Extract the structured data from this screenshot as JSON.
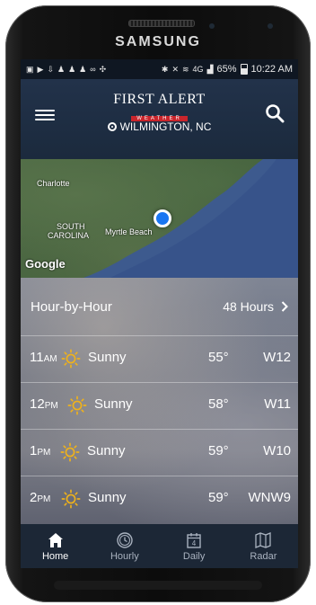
{
  "device": {
    "brand": "SAMSUNG"
  },
  "status_bar": {
    "battery_percent": "65%",
    "time": "10:22 AM",
    "network": "4G"
  },
  "app_bar": {
    "logo_top": "FIRST ALERT",
    "logo_bottom": "WEATHER",
    "location": "WILMINGTON, NC"
  },
  "map": {
    "labels": [
      "Charlotte",
      "SOUTH",
      "CAROLINA",
      "Myrtle Beach"
    ],
    "attribution": "Google"
  },
  "hourly": {
    "title": "Hour-by-Hour",
    "more_label": "48 Hours",
    "rows": [
      {
        "hour": "11",
        "period": "AM",
        "condition": "Sunny",
        "temp": "55°",
        "wind": "W12"
      },
      {
        "hour": "12",
        "period": "PM",
        "condition": "Sunny",
        "temp": "58°",
        "wind": "W11"
      },
      {
        "hour": "1",
        "period": "PM",
        "condition": "Sunny",
        "temp": "59°",
        "wind": "W10"
      },
      {
        "hour": "2",
        "period": "PM",
        "condition": "Sunny",
        "temp": "59°",
        "wind": "WNW9"
      }
    ]
  },
  "tabs": [
    {
      "label": "Home",
      "icon": "home-icon",
      "active": true
    },
    {
      "label": "Hourly",
      "icon": "clock-icon",
      "active": false
    },
    {
      "label": "Daily",
      "icon": "calendar-icon",
      "active": false,
      "badge": "4"
    },
    {
      "label": "Radar",
      "icon": "map-icon",
      "active": false
    }
  ],
  "colors": {
    "sun": "#f0b21a",
    "location_dot": "#1976f2",
    "logo_red": "#c9252c"
  }
}
